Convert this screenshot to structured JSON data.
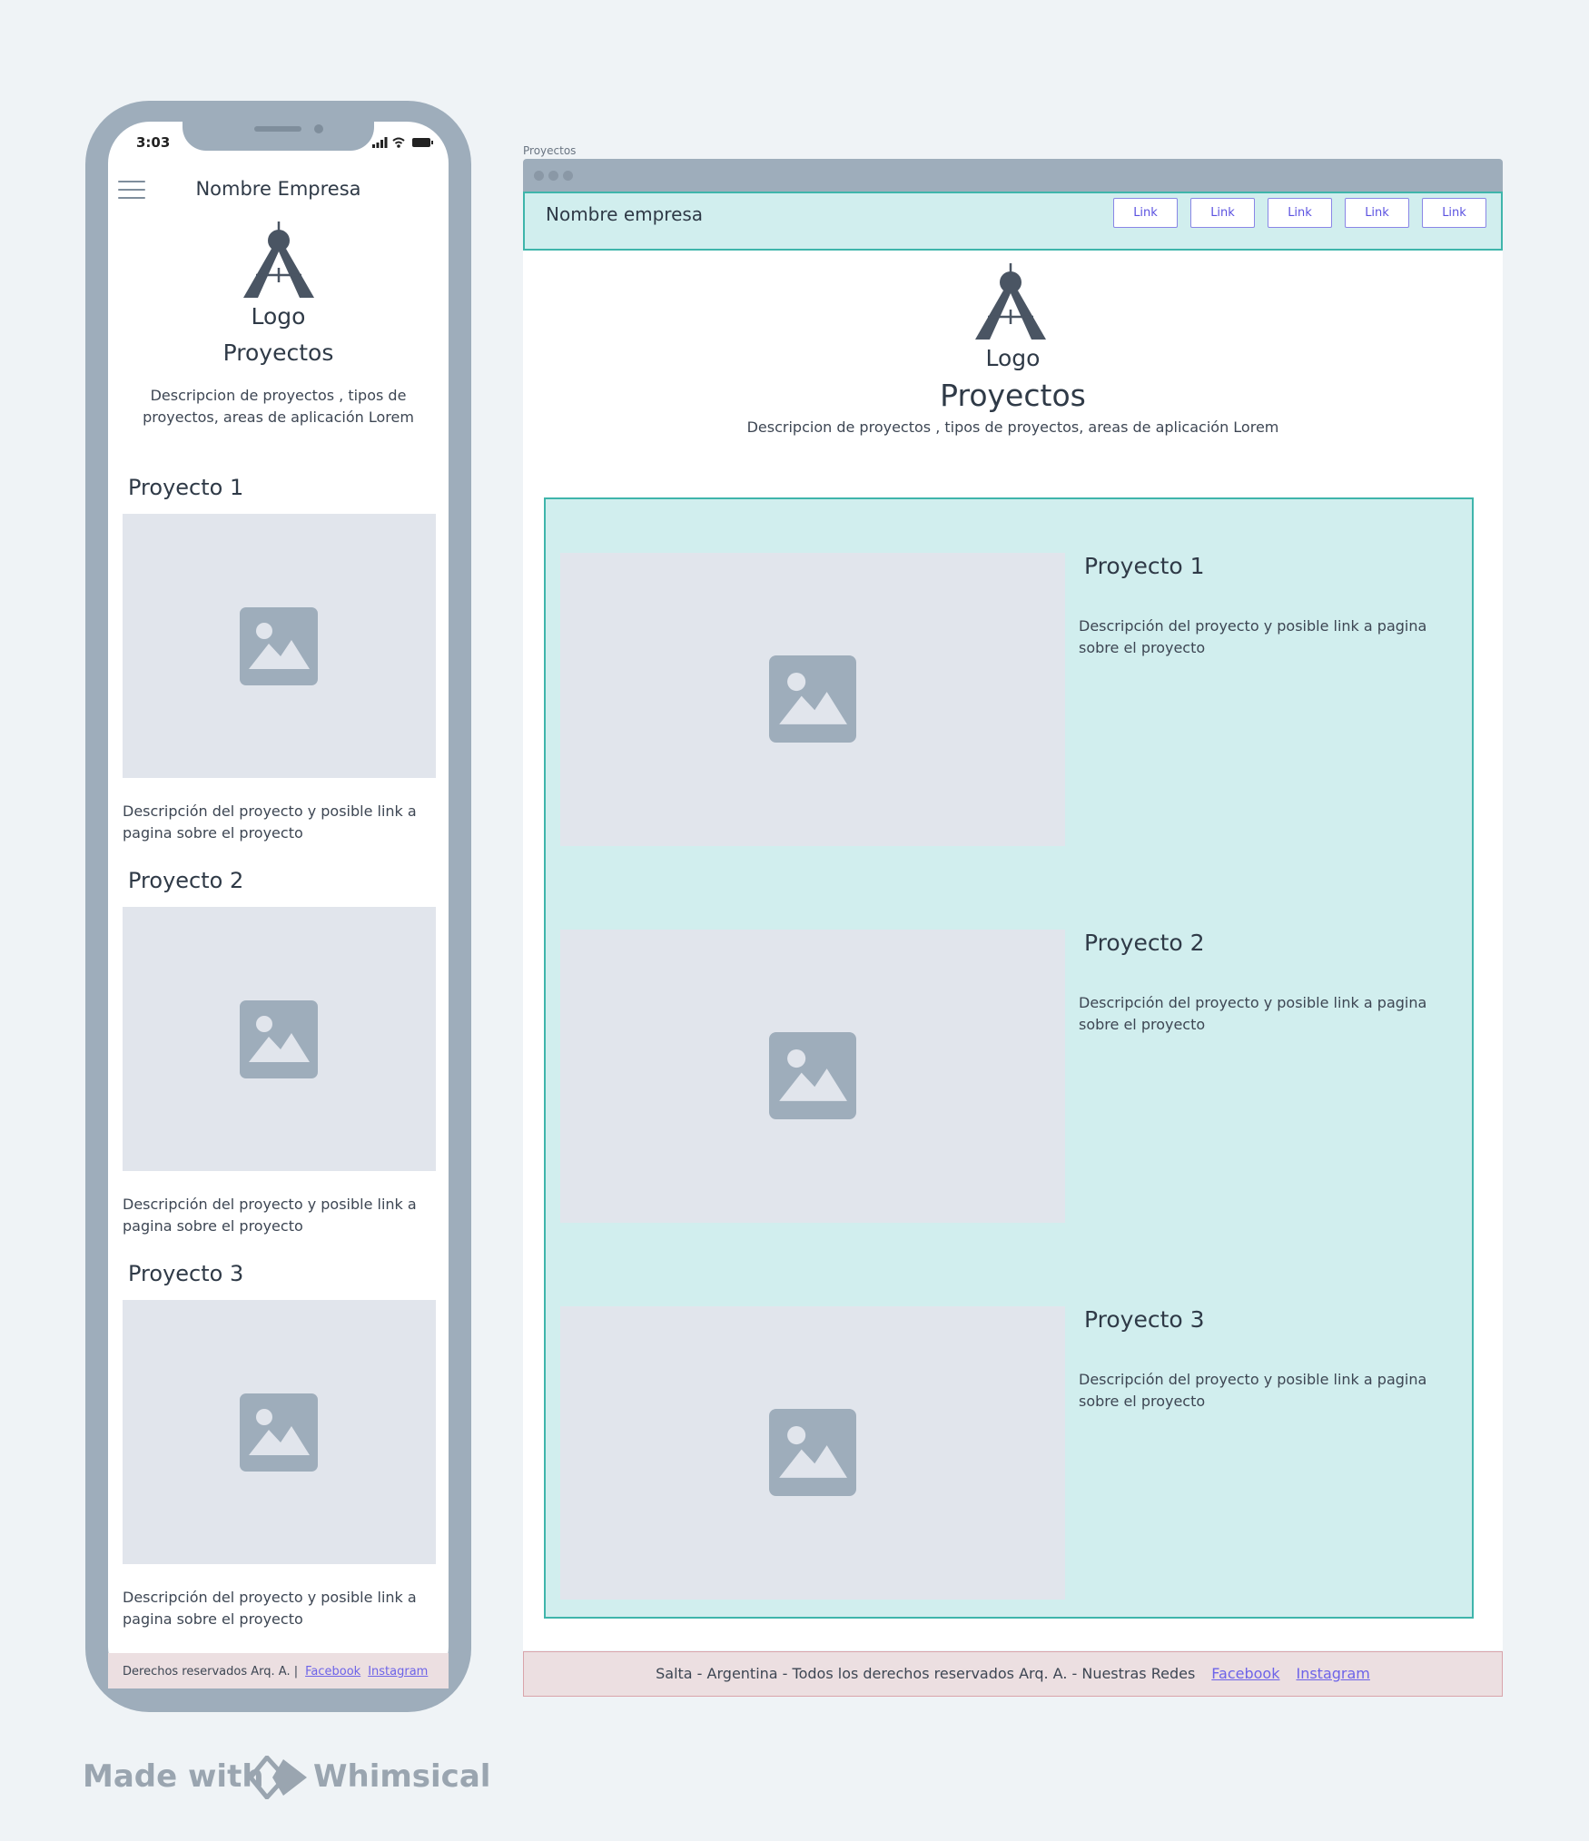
{
  "mobile": {
    "status_time": "3:03",
    "company_name": "Nombre Empresa",
    "logo_label": "Logo",
    "title": "Proyectos",
    "description": "Descripcion de proyectos , tipos de proyectos, areas de aplicación Lorem",
    "projects": [
      {
        "title": "Proyecto 1",
        "description": "Descripción del proyecto y posible link a pagina sobre el proyecto"
      },
      {
        "title": "Proyecto 2",
        "description": "Descripción del proyecto y posible link a pagina sobre el proyecto"
      },
      {
        "title": "Proyecto 3",
        "description": "Descripción del proyecto y posible link a pagina sobre el proyecto"
      }
    ],
    "footer": {
      "text": "Derechos reservados Arq. A.  |",
      "facebook": "Facebook",
      "instagram": "Instagram"
    }
  },
  "desktop": {
    "frame_caption": "Proyectos",
    "company_name": "Nombre empresa",
    "nav_links": [
      "Link",
      "Link",
      "Link",
      "Link",
      "Link"
    ],
    "logo_label": "Logo",
    "title": "Proyectos",
    "description": "Descripcion de proyectos , tipos de proyectos, areas de aplicación Lorem",
    "projects": [
      {
        "title": "Proyecto 1",
        "description": "Descripción del proyecto y posible link a pagina sobre el proyecto"
      },
      {
        "title": "Proyecto 2",
        "description": "Descripción del proyecto y posible link a pagina sobre el proyecto"
      },
      {
        "title": "Proyecto 3",
        "description": "Descripción del proyecto y posible link a pagina sobre el proyecto"
      }
    ],
    "footer": {
      "text": "Salta - Argentina - Todos los derechos reservados Arq. A.  - Nuestras Redes",
      "facebook": "Facebook",
      "instagram": "Instagram"
    }
  },
  "badge": {
    "made_with": "Made with",
    "brand": "Whimsical"
  },
  "colors": {
    "frame": "#9eadbb",
    "teal_bg": "#d1eeee",
    "teal_border": "#3fb5ab",
    "footer_bg": "#ecdfe1",
    "link": "#6d63e8",
    "placeholder": "#e1e5ec"
  },
  "icons": {
    "logo": "compass-logo-icon",
    "image": "image-placeholder-icon",
    "menu": "hamburger-menu-icon",
    "badge": "whimsical-diamond-icon"
  }
}
